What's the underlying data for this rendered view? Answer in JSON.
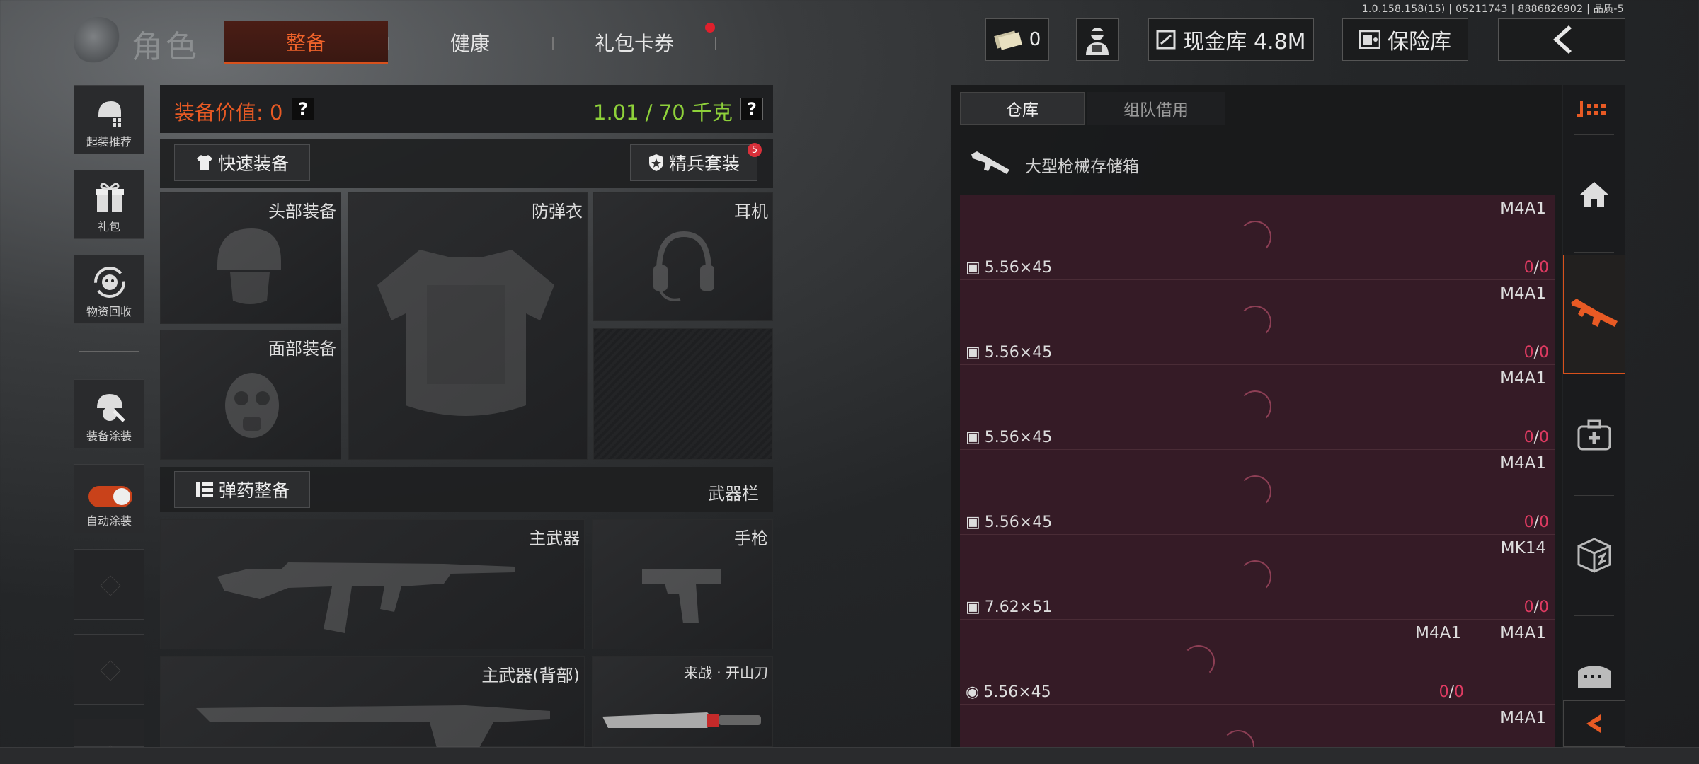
{
  "version": "1.0.158.158(15) | 05211743 | 8886826902 | 品质-5",
  "header": {
    "title": "角色",
    "tabs": [
      {
        "label": "整备",
        "active": true
      },
      {
        "label": "健康",
        "active": false
      },
      {
        "label": "礼包卡券",
        "active": false,
        "notification": true
      }
    ],
    "currency_value": "0",
    "cash_vault_label": "现金库 4.8M",
    "safe_label": "保险库"
  },
  "left_sidebar": {
    "items": [
      {
        "label": "起装推荐",
        "icon": "helmet-recommend-icon"
      },
      {
        "label": "礼包",
        "icon": "gift-icon"
      },
      {
        "label": "物资回收",
        "icon": "recycle-icon"
      },
      {
        "label": "装备涂装",
        "icon": "paint-icon"
      },
      {
        "label": "自动涂装",
        "icon": "toggle-icon",
        "toggled": true
      }
    ]
  },
  "equipment": {
    "value_label": "装备价值: 0",
    "weight_label": "1.01 / 70 千克",
    "quick_equip_label": "快速装备",
    "elite_set_label": "精兵套装",
    "elite_set_badge": "5",
    "slots": {
      "head": "头部装备",
      "armor": "防弹衣",
      "headset": "耳机",
      "face": "面部装备"
    },
    "ammo_button_label": "弹药整备",
    "weapon_bar_label": "武器栏",
    "weapon_slots": {
      "primary": "主武器",
      "pistol": "手枪",
      "primary_back": "主武器(背部)",
      "melee": "来战 · 开山刀"
    }
  },
  "storage": {
    "tabs": [
      {
        "label": "仓库",
        "active": true
      },
      {
        "label": "组队借用",
        "active": false
      }
    ],
    "container_name": "大型枪械存储箱",
    "rows": [
      {
        "weapon": "M4A1",
        "ammo": "5.56×45",
        "count": "0",
        "total": "0"
      },
      {
        "weapon": "M4A1",
        "ammo": "5.56×45",
        "count": "0",
        "total": "0"
      },
      {
        "weapon": "M4A1",
        "ammo": "5.56×45",
        "count": "0",
        "total": "0"
      },
      {
        "weapon": "M4A1",
        "ammo": "5.56×45",
        "count": "0",
        "total": "0"
      },
      {
        "weapon": "MK14",
        "ammo": "7.62×51",
        "count": "0",
        "total": "0"
      },
      {
        "weapon": "M4A1",
        "weapon2": "M4A1",
        "ammo": "5.56×45",
        "count": "0",
        "total": "0"
      },
      {
        "weapon": "M4A1",
        "ammo": "",
        "count": "",
        "total": ""
      }
    ]
  },
  "colors": {
    "accent": "#e85a24",
    "weight": "#8ed13a",
    "ammo_count": "#e03b62",
    "storage_bg": "#351b26"
  }
}
